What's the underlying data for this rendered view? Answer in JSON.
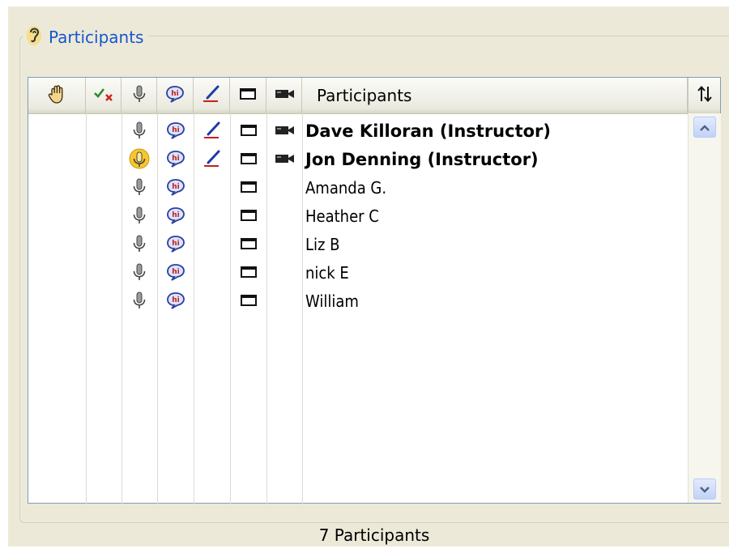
{
  "panel": {
    "title": "Participants",
    "header": {
      "name_column": "Participants"
    },
    "participants": [
      {
        "name": "Dave Killoran (Instructor)",
        "instructor": true,
        "talking": false
      },
      {
        "name": "Jon Denning (Instructor)",
        "instructor": true,
        "talking": true
      },
      {
        "name": "Amanda G.",
        "instructor": false,
        "talking": false
      },
      {
        "name": "Heather C",
        "instructor": false,
        "talking": false
      },
      {
        "name": "Liz B",
        "instructor": false,
        "talking": false
      },
      {
        "name": "nick E",
        "instructor": false,
        "talking": false
      },
      {
        "name": "William",
        "instructor": false,
        "talking": false
      }
    ],
    "footer": {
      "count": "7 Participants"
    }
  },
  "icons": {
    "legend": "ear-icon",
    "columns": [
      "raise-hand-icon",
      "yes-no-icon",
      "microphone-icon",
      "chat-icon",
      "whiteboard-pen-icon",
      "screen-share-icon",
      "webcam-icon"
    ],
    "sort": "sort-icon",
    "scroll_up": "scroll-up-arrow-icon",
    "scroll_down": "scroll-down-arrow-icon"
  },
  "colors": {
    "panel_background": "#ece9d8",
    "title_text": "#1556d0",
    "chat_icon": "#2a3f9c",
    "chat_icon_accent": "#c4201c",
    "talking_highlight": "#f7c62f",
    "pen_accent": "#1f3ba8"
  }
}
